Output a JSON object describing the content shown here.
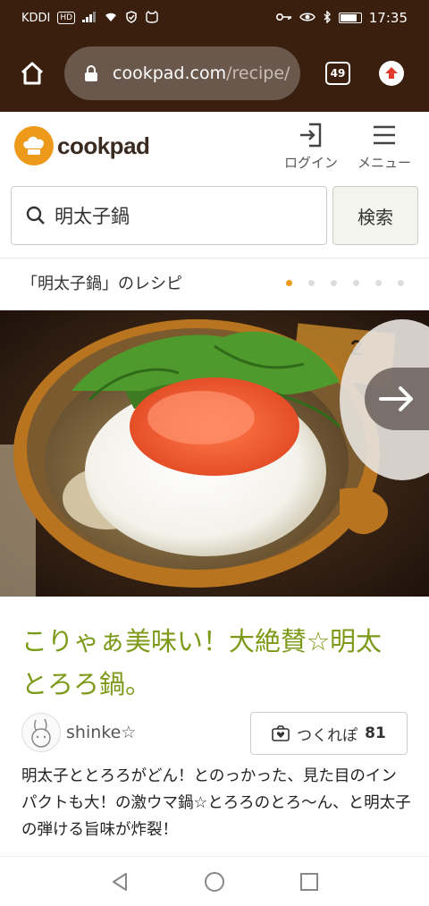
{
  "status_bar": {
    "carrier": "KDDI",
    "hd": "HD",
    "time": "17:35",
    "battery_level": 0.85
  },
  "browser": {
    "url_host": "cookpad.com",
    "url_path": "/recipe/",
    "tab_count": "49"
  },
  "header": {
    "logo_text": "cookpad",
    "login_label": "ログイン",
    "menu_label": "メニュー"
  },
  "search": {
    "query": "明太子鍋",
    "button_label": "検索"
  },
  "recipe_list": {
    "title": "「明太子鍋」のレシピ",
    "page_count": 6,
    "active_index": 0
  },
  "recipe": {
    "title": "こりゃぁ美味い！大絶賛☆明太とろろ鍋。",
    "author": "shinke☆",
    "tsukurepo_label": "つくれぽ",
    "tsukurepo_count": "81",
    "description": "明太子ととろろがどん！とのっかった、見た目のインパクトも大！の激ウマ鍋☆とろろのとろ〜ん、と明太子の弾ける旨味が炸裂！"
  },
  "colors": {
    "browser_bg": "#3b1f0e",
    "brand_orange": "#ed9a1a",
    "title_green": "#7c9a18"
  }
}
